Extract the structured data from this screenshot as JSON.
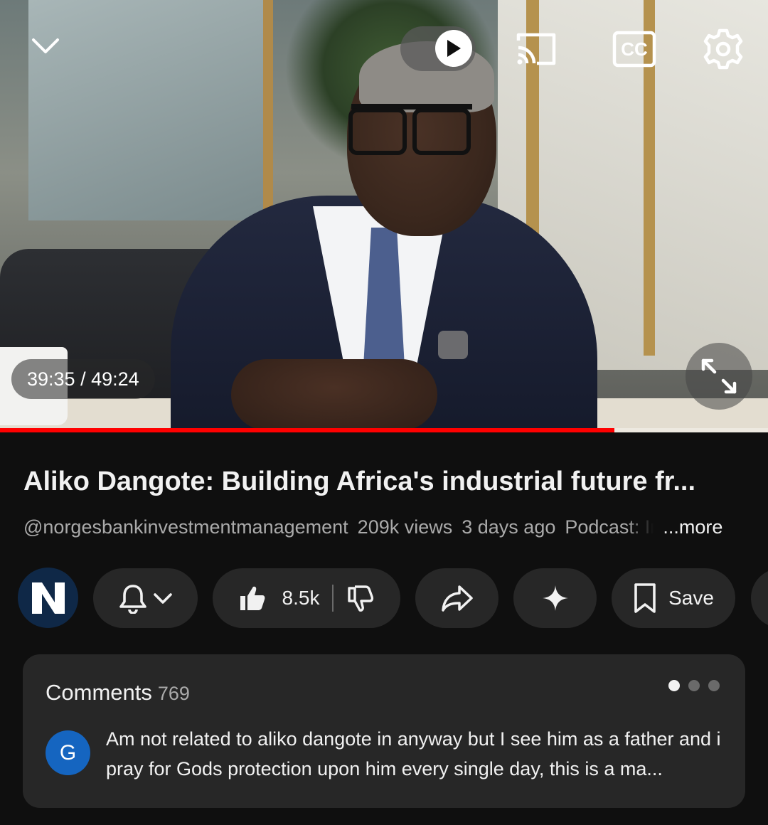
{
  "player": {
    "time_current": "39:35",
    "time_total": "49:24",
    "time_display": "39:35 / 49:24",
    "progress_fraction": 0.8,
    "progress_color": "#ff0000",
    "controls": [
      "chevron-down-icon",
      "autoplay-toggle",
      "cast-icon",
      "captions-icon",
      "settings-icon",
      "fullscreen-icon"
    ],
    "cc_label": "CC"
  },
  "video": {
    "title": "Aliko Dangote: Building Africa's industrial future fr...",
    "channel_handle": "@norgesbankinvestmentmanagement",
    "views": "209k views",
    "age": "3 days ago",
    "podcast_label": "Podcast: In",
    "more_label": "...more"
  },
  "actions": {
    "channel_avatar_letter": "N",
    "like_count": "8.5k",
    "save_label": "Save",
    "icons": [
      "bell-icon",
      "chevron-down-icon",
      "thumbs-up-icon",
      "thumbs-down-icon",
      "share-icon",
      "sparkle-icon",
      "bookmark-icon"
    ]
  },
  "comments": {
    "heading": "Comments",
    "count": "769",
    "first": {
      "avatar_letter": "G",
      "avatar_color": "#1565c0",
      "text": "Am not related to aliko dangote in anyway but I see him as a father and i pray for Gods protection upon him every single day, this is a ma..."
    }
  }
}
